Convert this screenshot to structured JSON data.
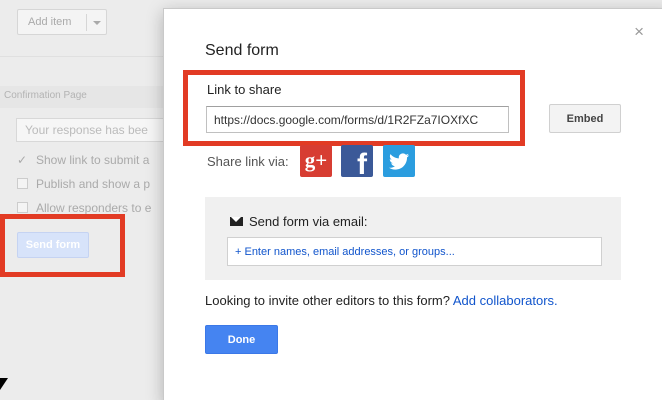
{
  "background": {
    "add_item_label": "Add item",
    "confirmation_tab": "Confirmation Page",
    "response_placeholder": "Your response has bee",
    "options": [
      {
        "label": "Show link to submit a",
        "checked": true
      },
      {
        "label": "Publish and show a p",
        "checked": false
      },
      {
        "label": "Allow responders to e",
        "checked": false
      }
    ],
    "send_form_button": "Send form"
  },
  "dialog": {
    "title": "Send form",
    "close_icon": "×",
    "link_label": "Link to share",
    "link_value": "https://docs.google.com/forms/d/1R2FZa7IOXfXC",
    "embed_button": "Embed",
    "share_via_label": "Share link via:",
    "social": {
      "gplus_glyph": "g+",
      "fb_glyph": "f"
    },
    "email_label": "Send form via email:",
    "email_placeholder": "+ Enter names, email addresses, or groups...",
    "invite_text": "Looking to invite other editors to this form?",
    "invite_link": "Add collaborators.",
    "done_button": "Done"
  },
  "colors": {
    "highlight_red": "#e23b24",
    "done_blue": "#4584f1",
    "link_blue": "#1155cc",
    "google_plus": "#d73d32",
    "facebook": "#3b5998",
    "twitter": "#2b9ddf"
  }
}
